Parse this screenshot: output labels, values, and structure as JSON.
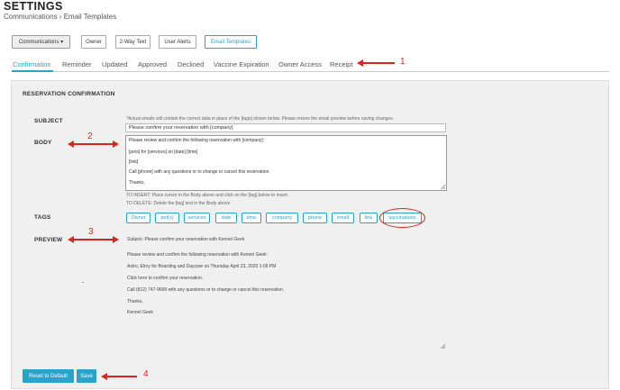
{
  "header": {
    "title": "SETTINGS",
    "breadcrumb": "Communications › Email Templates"
  },
  "toolbar": {
    "communications": "Communications ▾",
    "owner": "Owner",
    "two_way_text": "2-Way Text",
    "user_alerts": "User Alerts",
    "email_templates": "Email Templates"
  },
  "tabs": [
    {
      "label": "Confirmation"
    },
    {
      "label": "Reminder"
    },
    {
      "label": "Updated"
    },
    {
      "label": "Approved"
    },
    {
      "label": "Declined"
    },
    {
      "label": "Vaccine Expiration"
    },
    {
      "label": "Owner Access"
    },
    {
      "label": "Receipt"
    }
  ],
  "form": {
    "section_title": "RESERVATION CONFIRMATION",
    "subject_label": "SUBJECT",
    "subject_hint": "*Actual emails will contain the correct data in place of the [tags] shown below. Please review the email preview before saving changes.",
    "subject_value": "Please confirm your reservation with [company]",
    "body_label": "BODY",
    "body_lines": [
      "Please review and confirm the following reservation with [company]:",
      "[pets] for [services] on [date] [time]",
      "[link]",
      "Call [phone] with any questions or to change or cancel this reservation.",
      "Thanks,"
    ],
    "insert_hint": "TO INSERT: Place cursor in the Body above and click on the [tag] below to insert.",
    "delete_hint": "TO DELETE: Delete the [tag] text in the Body above",
    "tags_label": "TAGS",
    "tags": [
      "Owner",
      "pet(s)",
      "services",
      "date",
      "time",
      "company",
      "phone",
      "email",
      "link",
      "vaccinations"
    ],
    "preview_label": "PREVIEW",
    "preview_subject": "Subject: Please confirm your reservation with Kennel Geek",
    "preview_lines": [
      "Please review and confirm the following reservation with Kennel Geek:",
      "Astro, Elroy for Boarding and Daycare on Thursday April 23, 2020 1:09 PM",
      "Click here to confirm your reservation.",
      "Call (812) 747-9699 with any questions or to change or cancel this reservation.",
      "Thanks,",
      "Kennel Geek"
    ]
  },
  "actions": {
    "reset": "Reset to Default",
    "save": "Save"
  },
  "annotations": {
    "n1": "1",
    "n2": "2",
    "n3": "3",
    "n4": "4"
  },
  "colors": {
    "accent": "#2aa3c9",
    "annotation": "#d9261c",
    "panel_bg": "#f0f0f0"
  }
}
